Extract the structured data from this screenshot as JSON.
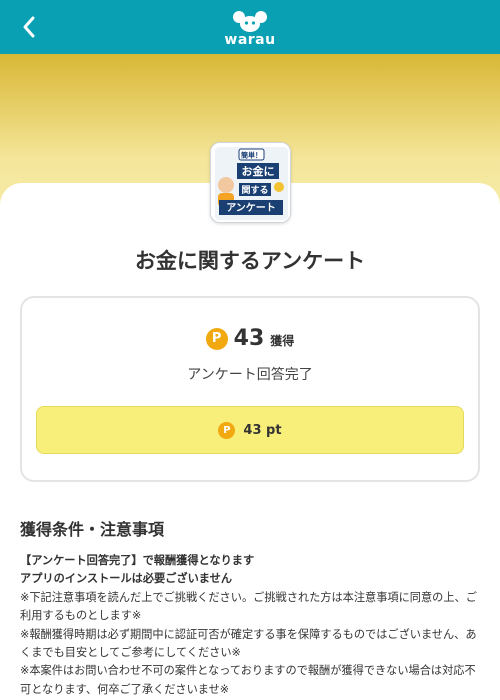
{
  "header": {
    "logo_text": "warau",
    "back_icon": "chevron-left-icon",
    "bg_color": "#0aa0b4"
  },
  "offer": {
    "thumbnail_texts": [
      "簡単！",
      "お金に",
      "関する",
      "アンケート"
    ],
    "title": "お金に関するアンケート"
  },
  "reward": {
    "coin_symbol": "P",
    "points": "43",
    "points_label": "獲得",
    "status": "アンケート回答完了",
    "button_label": "43 pt",
    "coin_color": "#f2a90f",
    "button_color": "#f8ef7a"
  },
  "conditions": {
    "heading": "獲得条件・注意事項",
    "lines": [
      "【アンケート回答完了】で報酬獲得となります",
      "アプリのインストールは必要ございません",
      "※下記注意事項を読んだ上でご挑戦ください。ご挑戦された方は本注意事項に同意の上、ご利用するものとします※",
      "※報酬獲得時期は必ず期間中に認証可否が確定する事を保障するものではございません、あくまでも目安としてご参考にしてください※",
      "※本案件はお問い合わせ不可の案件となっておりますので報酬が獲得できない場合は対応不可となります、何卒ご了承くださいませ※"
    ]
  }
}
